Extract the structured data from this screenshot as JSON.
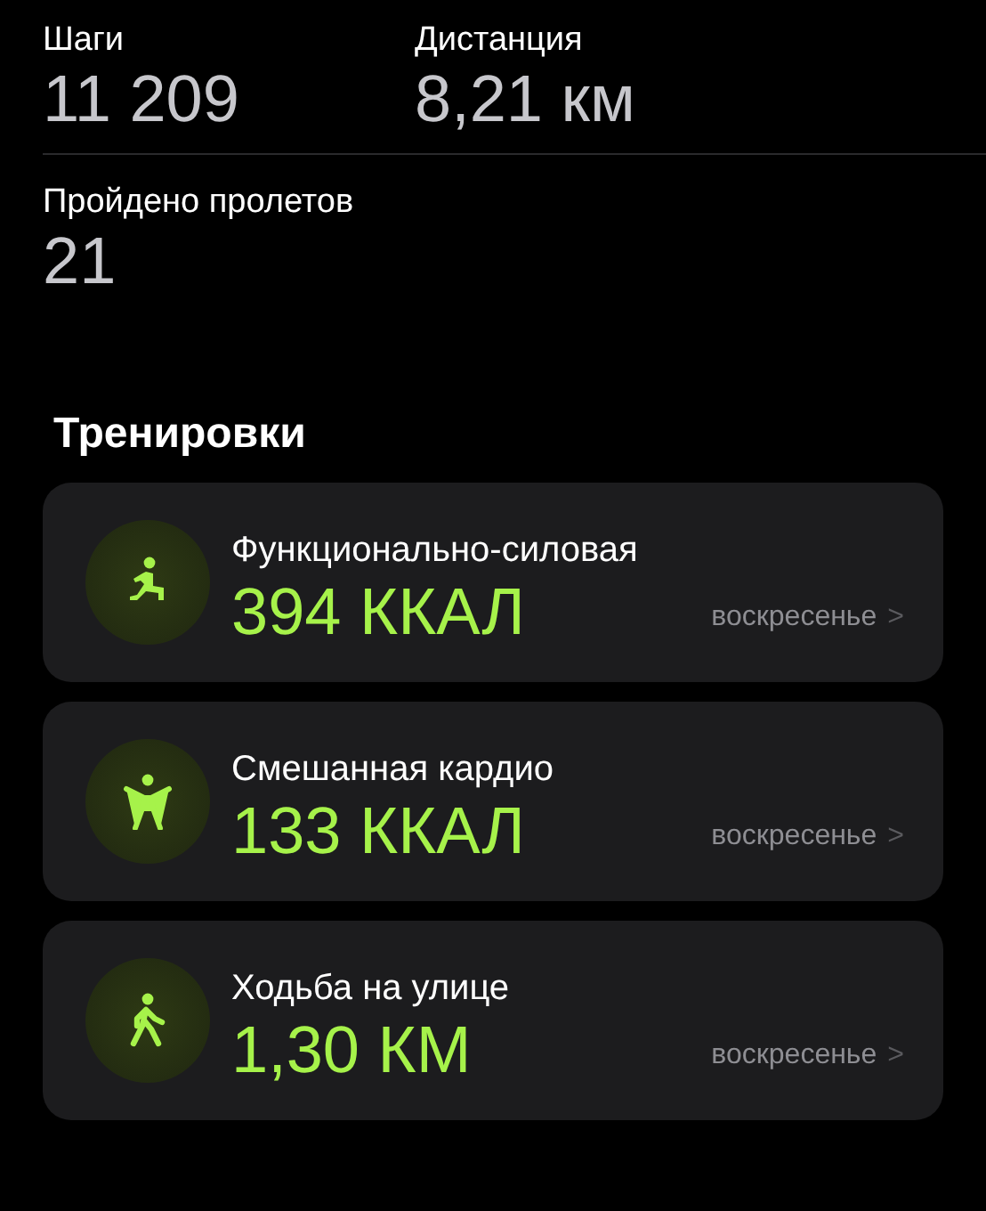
{
  "stats": [
    {
      "label": "Шаги",
      "value": "11 209"
    },
    {
      "label": "Дистанция",
      "value": "8,21 км"
    },
    {
      "label": "Пройдено пролетов",
      "value": "21"
    }
  ],
  "workouts": {
    "title": "Тренировки",
    "items": [
      {
        "kind": "strength",
        "name": "Функционально-силовая",
        "value": "394 ККАЛ",
        "day": "воскресенье",
        "chevron": ">"
      },
      {
        "kind": "cardio",
        "name": "Смешанная кардио",
        "value": "133 ККАЛ",
        "day": "воскресенье",
        "chevron": ">"
      },
      {
        "kind": "walking",
        "name": "Ходьба на улице",
        "value": "1,30 КМ",
        "day": "воскресенье",
        "chevron": ">"
      }
    ]
  }
}
